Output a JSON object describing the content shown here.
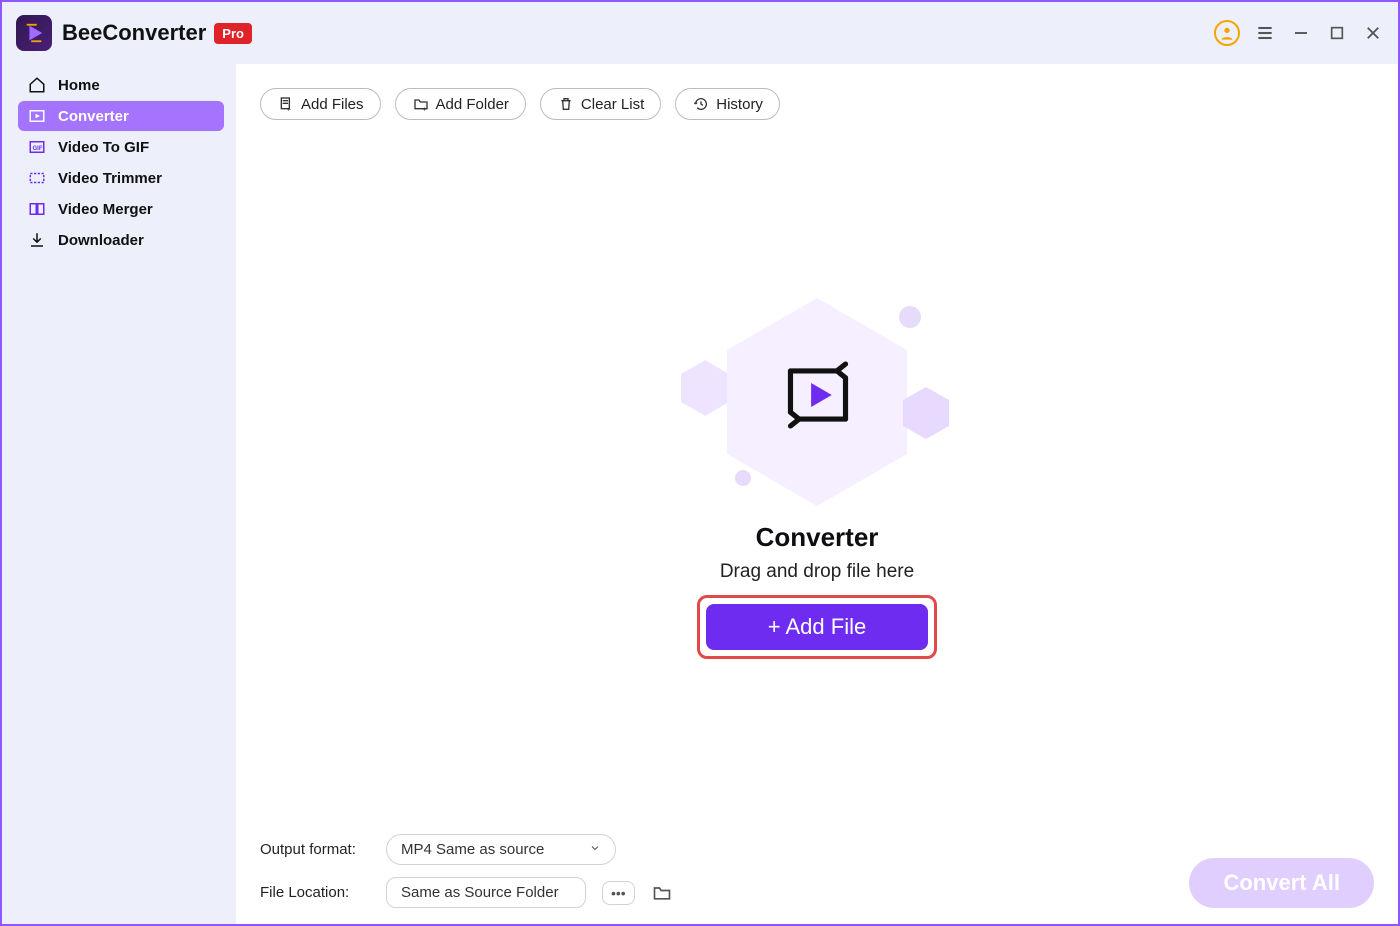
{
  "app": {
    "name": "BeeConverter",
    "badge": "Pro"
  },
  "sidebar": {
    "items": [
      {
        "label": "Home",
        "active": false
      },
      {
        "label": "Converter",
        "active": true
      },
      {
        "label": "Video To GIF",
        "active": false
      },
      {
        "label": "Video Trimmer",
        "active": false
      },
      {
        "label": "Video Merger",
        "active": false
      },
      {
        "label": "Downloader",
        "active": false
      }
    ]
  },
  "toolbar": {
    "add_files": "Add Files",
    "add_folder": "Add Folder",
    "clear_list": "Clear List",
    "history": "History"
  },
  "drop": {
    "title": "Converter",
    "subtitle": "Drag and drop file here",
    "button": "+ Add File"
  },
  "bottom": {
    "output_label": "Output format:",
    "output_value": "MP4 Same as source",
    "location_label": "File Location:",
    "location_value": "Same as Source Folder",
    "more": "•••",
    "convert_all": "Convert All"
  }
}
